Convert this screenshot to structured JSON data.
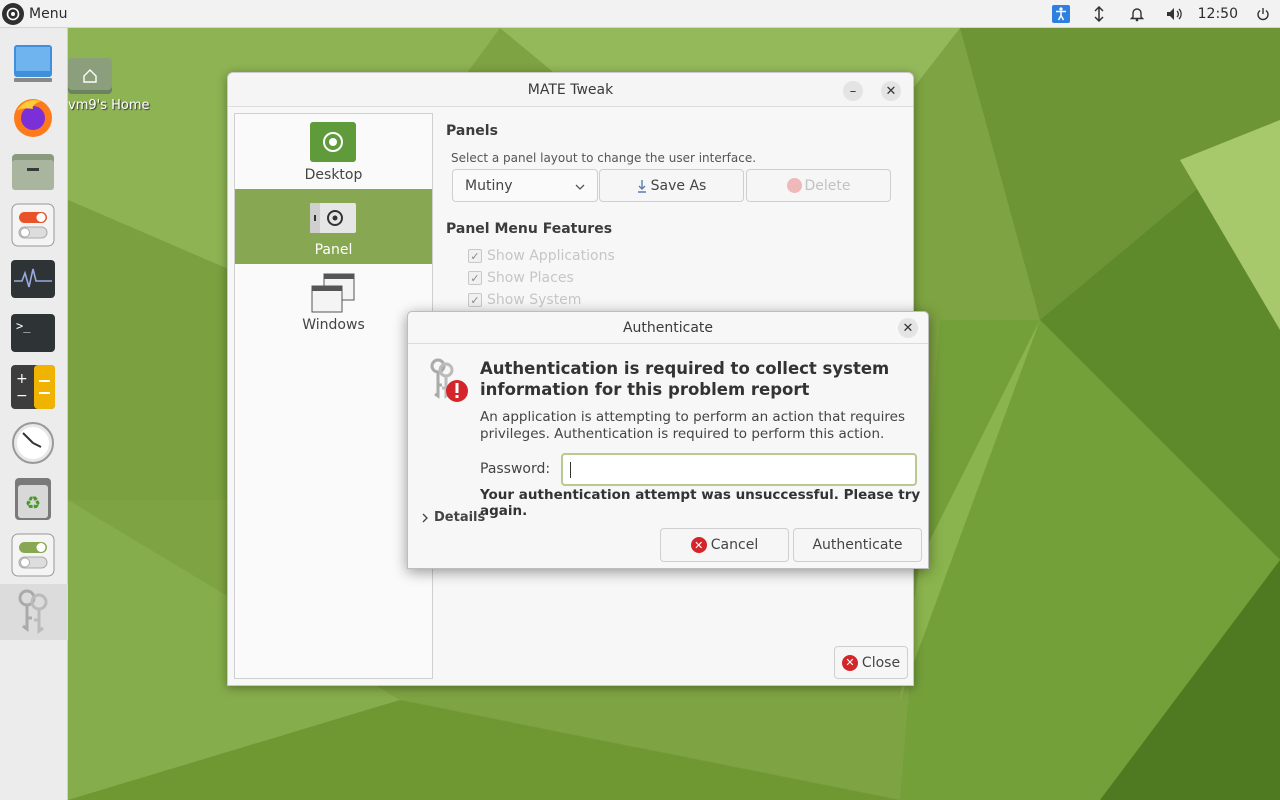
{
  "top_panel": {
    "menu_label": "Menu",
    "clock": "12:50",
    "tray_icons": [
      "accessibility-icon",
      "network-icon",
      "notification-icon",
      "volume-icon",
      "power-icon"
    ]
  },
  "dock": {
    "items": [
      "desktop-icon",
      "firefox-icon",
      "files-icon",
      "tweak-icon",
      "system-monitor-icon",
      "terminal-icon",
      "calculator-icon",
      "clock-icon",
      "trash-icon",
      "switches-icon",
      "keys-icon"
    ]
  },
  "desktop": {
    "home_label": "vm9's Home"
  },
  "tweak_window": {
    "title": "MATE Tweak",
    "sidebar": [
      {
        "label": "Desktop"
      },
      {
        "label": "Panel"
      },
      {
        "label": "Windows"
      }
    ],
    "panels_heading": "Panels",
    "panels_hint": "Select a panel layout to change the user interface.",
    "layout_value": "Mutiny",
    "save_as_label": "Save As",
    "delete_label": "Delete",
    "menu_features_heading": "Panel Menu Features",
    "features": [
      {
        "label": "Show Applications",
        "checked": true
      },
      {
        "label": "Show Places",
        "checked": true
      },
      {
        "label": "Show System",
        "checked": true
      }
    ],
    "close_label": "Close"
  },
  "auth_dialog": {
    "title": "Authenticate",
    "heading": "Authentication is required to collect system information for this problem report",
    "description": "An application is attempting to perform an action that requires privileges. Authentication is required to perform this action.",
    "password_label": "Password:",
    "password_value": "",
    "error": "Your authentication attempt was unsuccessful. Please try again.",
    "details_label": "Details",
    "cancel_label": "Cancel",
    "authenticate_label": "Authenticate"
  },
  "colors": {
    "accent": "#87a752",
    "error_red": "#d3262b"
  }
}
